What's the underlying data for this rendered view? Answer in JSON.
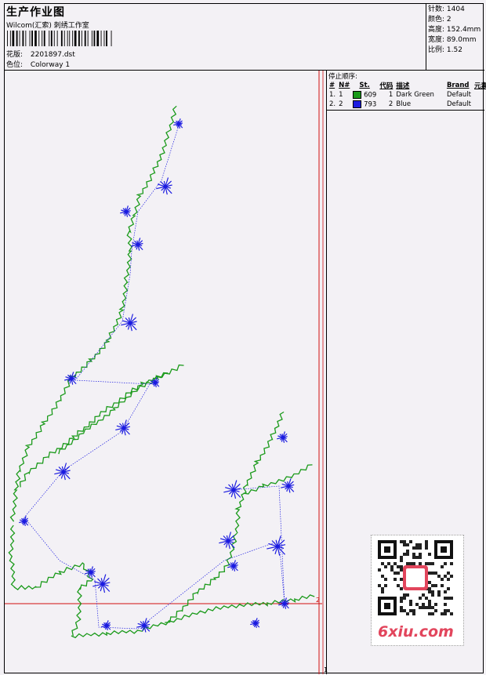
{
  "header": {
    "title": "生产作业图",
    "studio": "Wilcom(汇索) 刺绣工作室",
    "design_label": "花版:",
    "design_value": "2201897.dst",
    "colorway_label": "色位:",
    "colorway_value": "Colorway 1"
  },
  "stats": {
    "stitches_label": "针数:",
    "stitches": "1404",
    "colors_label": "颜色:",
    "colors": "2",
    "height_label": "高度:",
    "height": "152.4mm",
    "width_label": "宽度:",
    "width": "89.0mm",
    "scale_label": "比例:",
    "scale": "1.52"
  },
  "sequence": {
    "title": "停止顺序:",
    "columns": [
      "#",
      "N#",
      "St.",
      "代码",
      "描述",
      "Brand",
      "元素"
    ],
    "rows": [
      {
        "idx": "1.",
        "n": "1",
        "color": "#1a9a1a",
        "st": "609",
        "code": "1",
        "desc": "Dark Green",
        "brand": "Default"
      },
      {
        "idx": "2.",
        "n": "2",
        "color": "#1c1ce0",
        "st": "793",
        "code": "2",
        "desc": "Blue",
        "brand": "Default"
      }
    ]
  },
  "markers": {
    "right": "2",
    "bottom": "1"
  },
  "watermark": {
    "text": "6xiu.com"
  }
}
